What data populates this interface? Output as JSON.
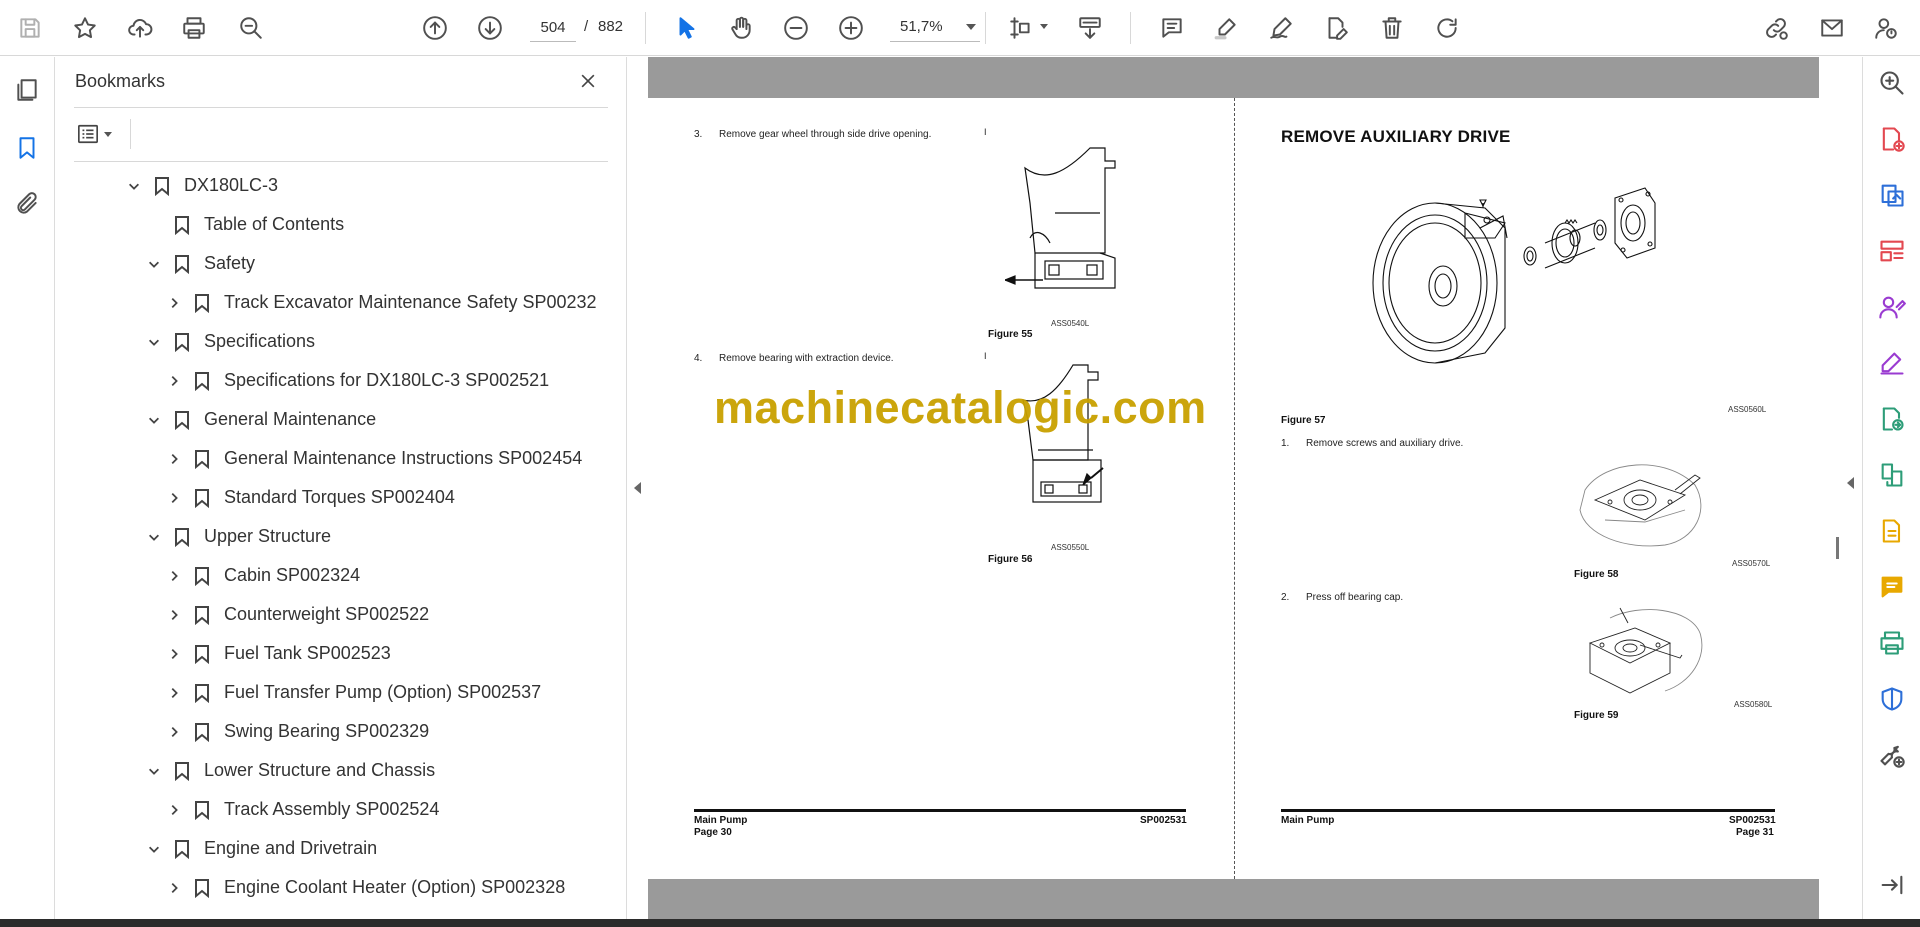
{
  "toolbar": {
    "current_page": "504",
    "separator": "/",
    "total_pages": "882",
    "zoom": "51,7%"
  },
  "bookmarks": {
    "title": "Bookmarks",
    "items": [
      {
        "label": "DX180LC-3",
        "level": 0,
        "chevron": "down"
      },
      {
        "label": "Table of Contents",
        "level": 1,
        "chevron": "none"
      },
      {
        "label": "Safety",
        "level": 1,
        "chevron": "down"
      },
      {
        "label": "Track Excavator Maintenance Safety SP002322",
        "level": 2,
        "chevron": "right"
      },
      {
        "label": "Specifications",
        "level": 1,
        "chevron": "down"
      },
      {
        "label": "Specifications for DX180LC-3 SP002521",
        "level": 2,
        "chevron": "right"
      },
      {
        "label": "General Maintenance",
        "level": 1,
        "chevron": "down"
      },
      {
        "label": "General Maintenance Instructions SP002454",
        "level": 2,
        "chevron": "right"
      },
      {
        "label": "Standard Torques SP002404",
        "level": 2,
        "chevron": "right"
      },
      {
        "label": "Upper Structure",
        "level": 1,
        "chevron": "down"
      },
      {
        "label": "Cabin SP002324",
        "level": 2,
        "chevron": "right"
      },
      {
        "label": "Counterweight SP002522",
        "level": 2,
        "chevron": "right"
      },
      {
        "label": "Fuel Tank SP002523",
        "level": 2,
        "chevron": "right"
      },
      {
        "label": "Fuel Transfer Pump (Option) SP002537",
        "level": 2,
        "chevron": "right"
      },
      {
        "label": "Swing Bearing SP002329",
        "level": 2,
        "chevron": "right"
      },
      {
        "label": "Lower Structure and Chassis",
        "level": 1,
        "chevron": "down"
      },
      {
        "label": "Track Assembly SP002524",
        "level": 2,
        "chevron": "right"
      },
      {
        "label": "Engine and Drivetrain",
        "level": 1,
        "chevron": "down"
      },
      {
        "label": "Engine Coolant Heater (Option) SP002328",
        "level": 2,
        "chevron": "right"
      }
    ]
  },
  "document": {
    "left_page": {
      "step3_num": "3.",
      "step3_text": "Remove gear wheel through side drive opening.",
      "fig55_code": "ASS0540L",
      "fig55_caption": "Figure 55",
      "step4_num": "4.",
      "step4_text": "Remove bearing with extraction device.",
      "fig56_code": "ASS0550L",
      "fig56_caption": "Figure 56",
      "footer_left_1": "Main Pump",
      "footer_left_2": "Page 30",
      "footer_right": "SP002531"
    },
    "right_page": {
      "heading": "REMOVE AUXILIARY DRIVE",
      "fig57_code": "ASS0560L",
      "fig57_caption": "Figure 57",
      "step1_num": "1.",
      "step1_text": "Remove screws and auxiliary drive.",
      "fig58_code": "ASS0570L",
      "fig58_caption": "Figure 58",
      "step2_num": "2.",
      "step2_text": "Press off bearing cap.",
      "fig59_code": "ASS0580L",
      "fig59_caption": "Figure 59",
      "footer_left": "Main Pump",
      "footer_right_1": "SP002531",
      "footer_right_2": "Page 31"
    },
    "watermark": "machinecatalogic.com"
  },
  "colors": {
    "accent_blue": "#1473e6",
    "watermark": "#c9a100",
    "rail_red": "#e34850",
    "rail_blue": "#2d6fd8",
    "rail_purple": "#9a3bd1",
    "rail_green": "#2d9d78",
    "rail_yellow": "#e8a800"
  }
}
